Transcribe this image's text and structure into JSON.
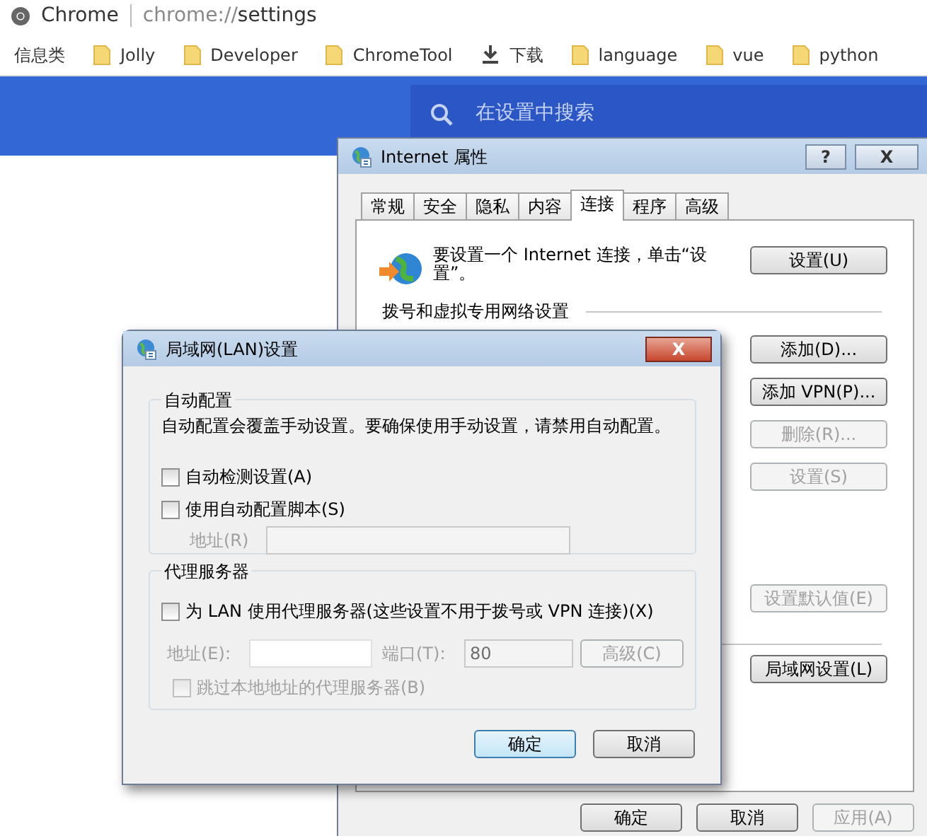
{
  "browser": {
    "title": "Chrome",
    "address": {
      "scheme": "chrome://",
      "path": "settings"
    },
    "bookmarks": [
      {
        "label": "信息类",
        "kind": "plain"
      },
      {
        "label": "Jolly",
        "kind": "folder"
      },
      {
        "label": "Developer",
        "kind": "folder"
      },
      {
        "label": "ChromeTool",
        "kind": "folder"
      },
      {
        "label": "下载",
        "kind": "download"
      },
      {
        "label": "language",
        "kind": "folder"
      },
      {
        "label": "vue",
        "kind": "folder"
      },
      {
        "label": "python",
        "kind": "folder"
      }
    ]
  },
  "settings_header": {
    "search": {
      "placeholder": "在设置中搜索"
    }
  },
  "internet_properties": {
    "title": "Internet 属性",
    "help_button": "?",
    "close_button": "X",
    "tabs": [
      {
        "label": "常规",
        "selected": false
      },
      {
        "label": "安全",
        "selected": false
      },
      {
        "label": "隐私",
        "selected": false
      },
      {
        "label": "内容",
        "selected": false
      },
      {
        "label": "连接",
        "selected": true
      },
      {
        "label": "程序",
        "selected": false
      },
      {
        "label": "高级",
        "selected": false
      }
    ],
    "setup_text": "要设置一个 Internet 连接，单击“设置”。",
    "setup_button": {
      "label": "设置(U)",
      "disabled": false
    },
    "section_title": "拨号和虚拟专用网络设置",
    "connection_buttons": [
      {
        "label": "添加(D)...",
        "disabled": false
      },
      {
        "label": "添加 VPN(P)...",
        "disabled": false
      },
      {
        "label": "删除(R)...",
        "disabled": true
      },
      {
        "label": "设置(S)",
        "disabled": true
      }
    ],
    "default_button": {
      "label": "设置默认值(E)",
      "disabled": true
    },
    "lan_button": {
      "label": "局域网设置(L)",
      "disabled": false
    },
    "buttons": [
      {
        "label": "确定",
        "disabled": false
      },
      {
        "label": "取消",
        "disabled": false
      },
      {
        "label": "应用(A)",
        "disabled": true
      }
    ]
  },
  "lan_dialog": {
    "title": "局域网(LAN)设置",
    "close_button": "X",
    "auto_config": {
      "title": "自动配置",
      "description": "自动配置会覆盖手动设置。要确保使用手动设置，请禁用自动配置。",
      "options": [
        {
          "label": "自动检测设置(A)",
          "checked": false,
          "disabled": false
        },
        {
          "label": "使用自动配置脚本(S)",
          "checked": false,
          "disabled": false
        }
      ],
      "address": {
        "label": "地址(R)",
        "disabled": true
      }
    },
    "proxy": {
      "title": "代理服务器",
      "use_proxy": {
        "label": "为 LAN 使用代理服务器(这些设置不用于拨号或 VPN 连接)(X)",
        "checked": false,
        "disabled": false
      },
      "address": {
        "label": "地址(E):",
        "disabled": true
      },
      "port": {
        "label": "端口(T):",
        "value": "80",
        "disabled": true
      },
      "advanced": {
        "label": "高级(C)",
        "disabled": true
      },
      "bypass": {
        "label": "跳过本地地址的代理服务器(B)",
        "checked": false,
        "disabled": true
      }
    },
    "buttons": [
      {
        "label": "确定",
        "default": true
      },
      {
        "label": "取消",
        "default": false
      }
    ]
  }
}
